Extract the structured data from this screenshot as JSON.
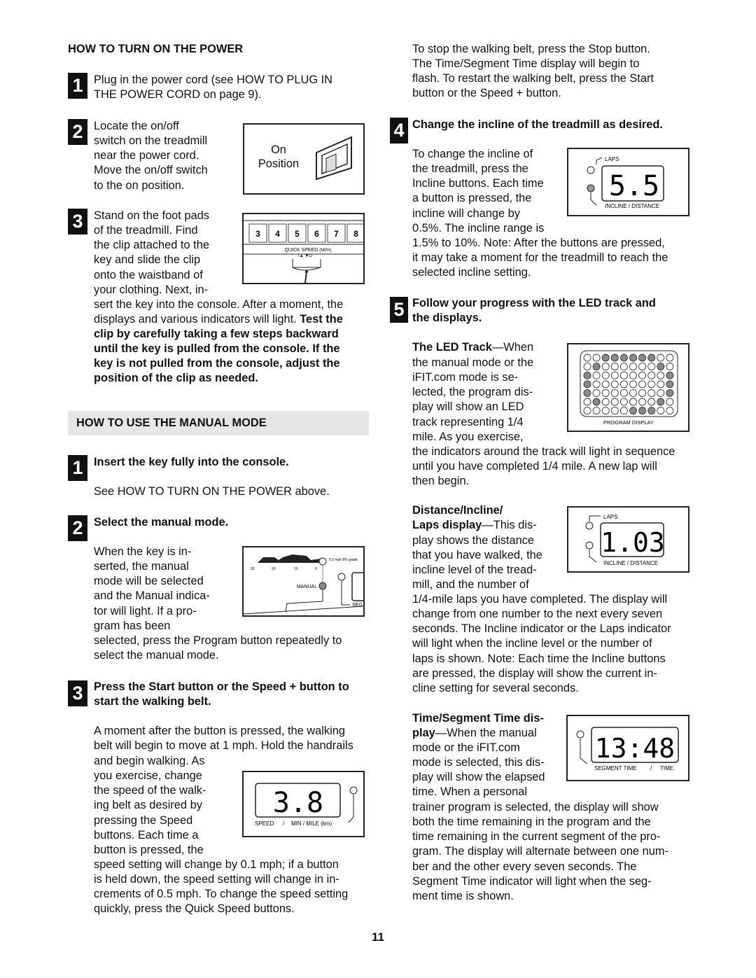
{
  "power": {
    "heading": "HOW TO TURN ON THE POWER",
    "step1": {
      "num": "1",
      "text": "Plug in the power cord (see HOW TO PLUG IN\nTHE POWER CORD on page 9)."
    },
    "step2": {
      "num": "2",
      "text": "Locate the on/off\nswitch on the treadmill\nnear the power cord.\nMove the on/off switch\nto the on position.",
      "figure_label": "On\nPosition"
    },
    "step3": {
      "num": "3",
      "text_narrow": "Stand on the foot pads\nof the treadmill. Find\nthe clip attached to the\nkey and slide the clip\nonto the waistband of\nyour clothing. Next, in-",
      "text_wide": "sert the key into the console. After a moment, the\ndisplays and various indicators will light. ",
      "text_bold": "Test the",
      "text_bold_lines": "clip by carefully taking a few steps backward\nuntil the key is pulled from the console. If the\nkey is not pulled from the console, adjust the\nposition of the clip as needed.",
      "figure": {
        "keys": [
          "3",
          "4",
          "5",
          "6",
          "7",
          "8"
        ],
        "label": "QUICK SPEED",
        "unit": "(MPH)",
        "arrows": "I▲   ▼O"
      }
    }
  },
  "manual": {
    "heading": "HOW TO USE THE MANUAL MODE",
    "step1": {
      "num": "1",
      "title": "Insert the key fully into the console.",
      "text": "See HOW TO TURN ON THE POWER above."
    },
    "step2": {
      "num": "2",
      "title": "Select the manual mode.",
      "text_narrow": "When the key is in-\nserted, the manual\nmode will be selected\nand the Manual indica-\ntor will light. If a pro-\ngram has been",
      "text_wide": "selected, press the Program button repeatedly to\nselect the manual mode.",
      "figure": {
        "ticks": [
          "30",
          "20",
          "10",
          "0"
        ],
        "workout": "5.0 mph\n8% grade",
        "manual": "MANUAL",
        "seg": "SEG"
      }
    },
    "step3": {
      "num": "3",
      "title": "Press the Start button or the Speed + button to\nstart the walking belt.",
      "text_wide1": "A moment after the button is pressed, the walking\nbelt will begin to move at 1 mph. Hold the handrails",
      "text_narrow": "and begin walking. As\nyou exercise, change\nthe speed of the walk-\ning belt as desired by\npressing the Speed\nbuttons. Each time a\nbutton is pressed, the",
      "text_wide2": "speed setting will change by 0.1 mph; if a button\nis held down, the speed setting will change in in-\ncrements of 0.5 mph. To change the speed setting\nquickly, press the Quick Speed buttons.",
      "figure": {
        "value": "3.8",
        "label_left": "SPEED",
        "sep": "/",
        "label_right": "MIN / MILE (km)"
      }
    }
  },
  "right": {
    "stop_text": "To stop the walking belt, press the Stop button.\nThe Time/Segment Time display will begin to\nflash. To restart the walking belt, press the Start\nbutton or the Speed + button.",
    "step4": {
      "num": "4",
      "title": "Change the incline of the treadmill as desired.",
      "text_narrow": "To change the incline of\nthe treadmill, press the\nIncline buttons. Each time\na button is pressed, the\nincline will change by\n0.5%. The incline range is",
      "text_wide": "1.5% to 10%. Note: After the buttons are pressed,\nit may take a moment for the treadmill to reach the\nselected incline setting.",
      "figure": {
        "top": "LAPS",
        "value": "5.5",
        "bottom": "INCLINE / DISTANCE"
      }
    },
    "step5": {
      "num": "5",
      "title": "Follow your progress with the LED track and\nthe displays."
    },
    "led": {
      "title": "The LED Track",
      "dash_text": "—When",
      "text_narrow": "the manual mode or the\niFIT.com mode is se-\nlected, the program dis-\nplay will show an LED\ntrack representing 1/4\nmile. As you exercise,",
      "text_wide": "the indicators around the track will light in sequence\nuntil you have completed 1/4 mile. A new lap will\nthen begin.",
      "figure": {
        "label": "PROGRAM DISPLAY",
        "lit": [
          [
            2,
            3,
            4,
            5,
            6,
            7
          ],
          [
            1,
            8
          ],
          [
            0,
            9
          ],
          [
            0,
            9
          ],
          [
            0,
            9
          ],
          [
            1,
            8
          ],
          [
            5,
            6,
            7
          ]
        ]
      }
    },
    "distance": {
      "title1": "Distance/Incline/",
      "title2": "Laps display",
      "dash_text": "—This dis-",
      "text_narrow": "play shows the distance\nthat you have walked, the\nincline level of the tread-\nmill, and the number of",
      "text_wide": "1/4-mile laps you have completed. The display will\nchange from one number to the next every seven\nseconds. The Incline indicator or the Laps indicator\nwill light when the incline level or the number of\nlaps is shown. Note: Each time the Incline buttons\nare pressed, the display will show the current in-\ncline setting for several seconds.",
      "figure": {
        "top": "LAPS",
        "value": "1.03",
        "bottom": "INCLINE / DISTANCE"
      }
    },
    "time": {
      "title1": "Time/Segment Time dis-",
      "title2": "play",
      "dash_text": "—When the manual",
      "text_narrow": "mode or the iFIT.com\nmode is selected, this dis-\nplay will show the elapsed\ntime. When a personal",
      "text_wide": "trainer program is selected, the display will show\nboth the time remaining in the program and the\ntime remaining in the current segment of the pro-\ngram. The display will alternate between one num-\nber and the other every seven seconds. The\nSegment Time indicator will light when the seg-\nment time is shown.",
      "figure": {
        "value": "13:48",
        "label_left": "SEGMENT TIME",
        "sep": "/",
        "label_right": "TIME"
      }
    }
  },
  "page_number": "11"
}
